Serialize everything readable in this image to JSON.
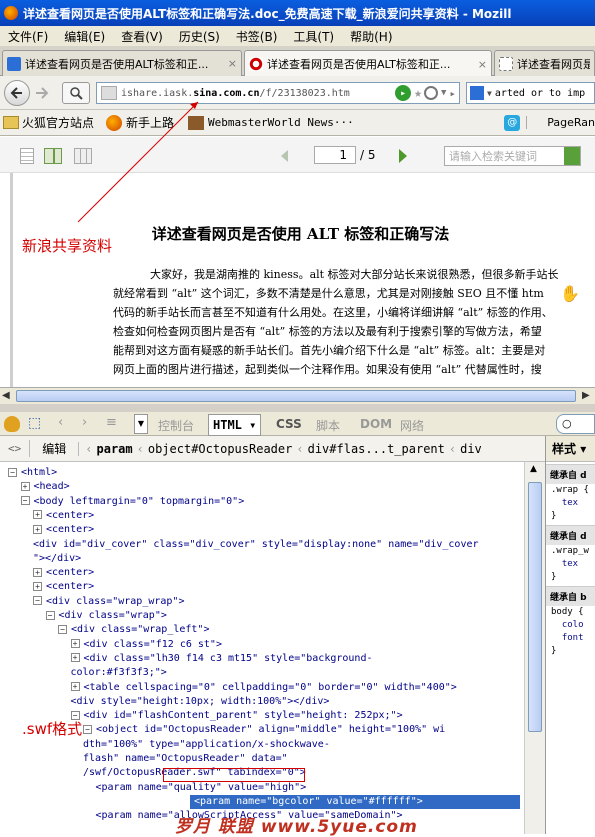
{
  "window": {
    "title": "详述查看网页是否使用ALT标签和正确写法.doc_免费高速下载_新浪爱问共享资料 - Mozill"
  },
  "menu": [
    "文件(F)",
    "编辑(E)",
    "查看(V)",
    "历史(S)",
    "书签(B)",
    "工具(T)",
    "帮助(H)"
  ],
  "tabs": [
    {
      "label": "详述查看网页是否使用ALT标签和正...",
      "close": "×"
    },
    {
      "label": "详述查看网页是否使用ALT标签和正...",
      "close": "×"
    },
    {
      "label": "详述查看网页是否使用ALT标签和正..."
    }
  ],
  "nav": {
    "url_prefix": "ishare.iask.",
    "url_domain": "sina.com.cn",
    "url_path": "/f/23138023.htm",
    "search_text": "arted or to imp"
  },
  "bookmarks": [
    "火狐官方站点",
    "新手上路",
    "WebmasterWorld News···",
    "PageRan"
  ],
  "viewer": {
    "page_current": "1",
    "page_total": "/ 5",
    "search_placeholder": "请输入检索关键词",
    "doc_title": "详述查看网页是否使用 ALT 标签和正确写法",
    "paragraphs": [
      "大家好，我是湖南推的 kiness。alt 标签对大部分站长来说很熟悉，但很多新手站长",
      "就经常看到 “alt” 这个词汇，多数不清楚是什么意思，尤其是对刚接触 SEO 且不懂 htm",
      "代码的新手站长而言甚至不知道有什么用处。在这里，小编将详细讲解 “alt” 标签的作用、",
      "检查如何检查网页图片是否有 “alt” 标签的方法以及最有利于搜索引擎的写做方法，希望",
      "能帮到对这方面有疑惑的新手站长们。首先小编介绍下什么是 “alt” 标签。alt：主要是对",
      "网页上面的图片进行描述，起到类似一个注释作用。如果没有使用 “alt” 代替属性时，搜"
    ]
  },
  "annotations": {
    "share": "新浪共享资料",
    "swf": ".swf格式"
  },
  "firebug": {
    "tabs": [
      "控制台",
      "HTML",
      "CSS",
      "脚本",
      "DOM",
      "网络"
    ],
    "edit_label": "编辑",
    "breadcrumb": [
      "param",
      "object#OctopusReader",
      "div#flas...t_parent",
      "div"
    ],
    "style_tab": "样式",
    "tree": [
      {
        "indent": 0,
        "exp": "-",
        "text": "<html>"
      },
      {
        "indent": 1,
        "exp": "+",
        "text": "<head>"
      },
      {
        "indent": 1,
        "exp": "-",
        "text": "<body leftmargin=\"0\" topmargin=\"0\">"
      },
      {
        "indent": 2,
        "exp": "+",
        "text": "<center>"
      },
      {
        "indent": 2,
        "exp": "+",
        "text": "<center>"
      },
      {
        "indent": 2,
        "exp": "",
        "text": "<div id=\"div_cover\" class=\"div_cover\" style=\"display:none\" name=\"div_cover"
      },
      {
        "indent": 2,
        "exp": "",
        "text": "\"></div>"
      },
      {
        "indent": 2,
        "exp": "+",
        "text": "<center>"
      },
      {
        "indent": 2,
        "exp": "+",
        "text": "<center>"
      },
      {
        "indent": 2,
        "exp": "-",
        "text": "<div class=\"wrap_wrap\">"
      },
      {
        "indent": 3,
        "exp": "-",
        "text": "<div class=\"wrap\">"
      },
      {
        "indent": 4,
        "exp": "-",
        "text": "<div class=\"wrap_left\">"
      },
      {
        "indent": 5,
        "exp": "+",
        "text": "<div class=\"f12 c6 st\">"
      },
      {
        "indent": 5,
        "exp": "+",
        "text": "<div class=\"lh30 f14 c3 mt15\" style=\"background-"
      },
      {
        "indent": 5,
        "exp": "",
        "text": "color:#f3f3f3;\">"
      },
      {
        "indent": 5,
        "exp": "+",
        "text": "<table cellspacing=\"0\" cellpadding=\"0\" border=\"0\" width=\"400\">"
      },
      {
        "indent": 5,
        "exp": "",
        "text": "<div style=\"height:10px; width:100%\"></div>"
      },
      {
        "indent": 5,
        "exp": "-",
        "text": "<div id=\"flashContent_parent\" style=\"height: 252px;\">"
      },
      {
        "indent": 6,
        "exp": "-",
        "text": "<object id=\"OctopusReader\" align=\"middle\" height=\"100%\" wi"
      },
      {
        "indent": 6,
        "exp": "",
        "text": "dth=\"100%\" type=\"application/x-shockwave-"
      },
      {
        "indent": 6,
        "exp": "",
        "text": "flash\" name=\"OctopusReader\" data=\""
      },
      {
        "indent": 6,
        "exp": "",
        "text": "/swf/OctopusReader.swf\" tabindex=\"0\">"
      },
      {
        "indent": 7,
        "exp": "",
        "text": "<param name=\"quality\" value=\"high\">"
      },
      {
        "indent": 7,
        "exp": "",
        "text": "<param name=\"bgcolor\" value=\"#ffffff\">"
      },
      {
        "indent": 7,
        "exp": "",
        "text": "<param name=\"allowScriptAccess\" value=\"sameDomain\">"
      }
    ],
    "styles": [
      {
        "header": "继承自 d",
        "body": [
          ".wrap {",
          "  tex",
          "}"
        ]
      },
      {
        "header": "继承自 d",
        "body": [
          ".wrap_w",
          "  tex",
          "}"
        ]
      },
      {
        "header": "继承自 b",
        "body": [
          "body {",
          "  colo",
          "  font",
          "}"
        ]
      }
    ]
  },
  "watermark": "罗月 联盟 www.5yue.com",
  "colors": {
    "titlebar": "#0a5ee0",
    "annotation": "#d40000",
    "selected_row": "#316ac5"
  }
}
